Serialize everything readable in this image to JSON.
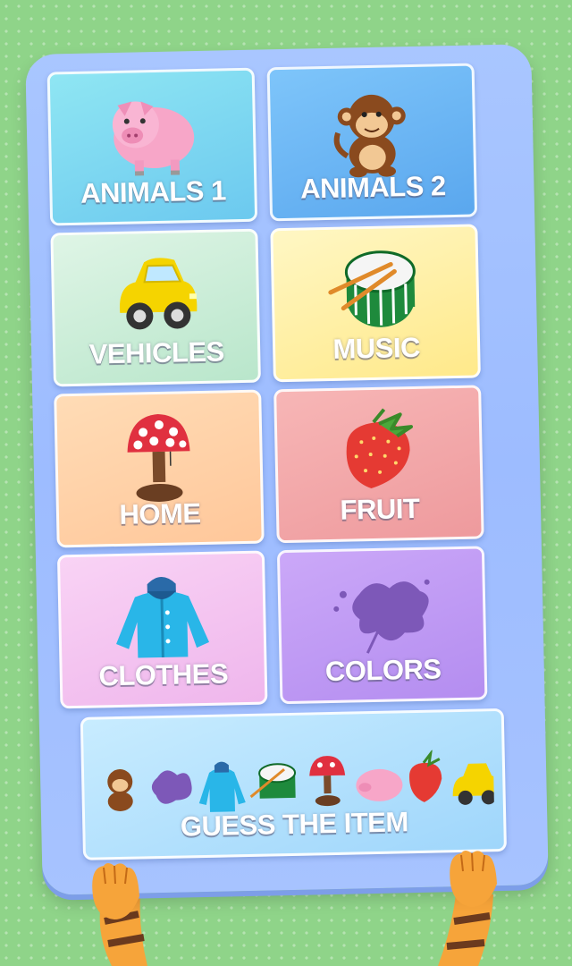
{
  "menu": {
    "categories": [
      {
        "id": "animals-1",
        "label": "ANIMALS 1",
        "icon": "pig-icon"
      },
      {
        "id": "animals-2",
        "label": "ANIMALS 2",
        "icon": "monkey-icon"
      },
      {
        "id": "vehicles",
        "label": "VEHICLES",
        "icon": "car-icon"
      },
      {
        "id": "music",
        "label": "MUSIC",
        "icon": "drum-icon"
      },
      {
        "id": "home",
        "label": "HOME",
        "icon": "lamp-icon"
      },
      {
        "id": "fruit",
        "label": "FRUIT",
        "icon": "strawberry-icon"
      },
      {
        "id": "clothes",
        "label": "CLOTHES",
        "icon": "jacket-icon"
      },
      {
        "id": "colors",
        "label": "COLORS",
        "icon": "paint-splat-icon"
      }
    ],
    "guess": {
      "label": "GUESS THE ITEM",
      "icons": [
        "monkey-icon",
        "paint-splat-icon",
        "jacket-icon",
        "drum-icon",
        "lamp-icon",
        "pig-icon",
        "strawberry-icon",
        "car-icon"
      ]
    }
  },
  "colors": {
    "background": "#8fd489",
    "board": "#a9c6ff",
    "tile_animals_1": "#7fd8ef",
    "tile_animals_2": "#6fb4f3",
    "tile_vehicles": "#c9ecd7",
    "tile_music": "#fff0a8",
    "tile_home": "#ffd4a8",
    "tile_fruit": "#f3a8a8",
    "tile_clothes": "#f3c2f0",
    "tile_colors": "#c5a2f5",
    "tile_guess": "#b6e3ff"
  }
}
